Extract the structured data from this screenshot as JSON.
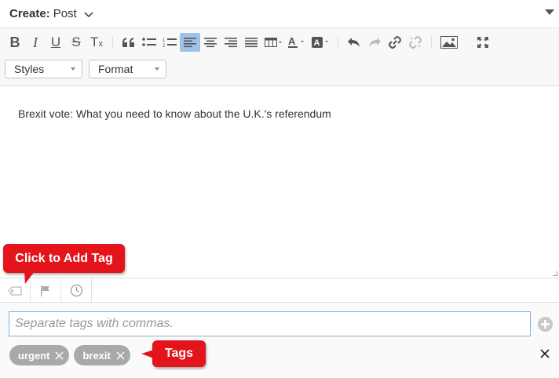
{
  "header": {
    "create_label": "Create:",
    "type_value": "Post"
  },
  "toolbar": {
    "buttons": [
      "bold",
      "italic",
      "underline",
      "strikethrough",
      "remove-format",
      "blockquote",
      "bulleted-list",
      "numbered-list",
      "align-left",
      "align-center",
      "align-right",
      "justify",
      "table",
      "text-color",
      "background-color",
      "undo",
      "redo",
      "link",
      "unlink",
      "image",
      "maximize"
    ],
    "active_button": "align-left",
    "styles_label": "Styles",
    "format_label": "Format",
    "accent_color": "#9fc3e6"
  },
  "editor": {
    "content": "Brexit vote: What you need to know about the U.K.'s referendum"
  },
  "tags": {
    "placeholder": "Separate tags with commas.",
    "items": [
      {
        "label": "urgent"
      },
      {
        "label": "brexit"
      }
    ]
  },
  "callouts": {
    "add_tag": "Click to Add Tag",
    "tags": "Tags",
    "color": "#e3141b"
  }
}
